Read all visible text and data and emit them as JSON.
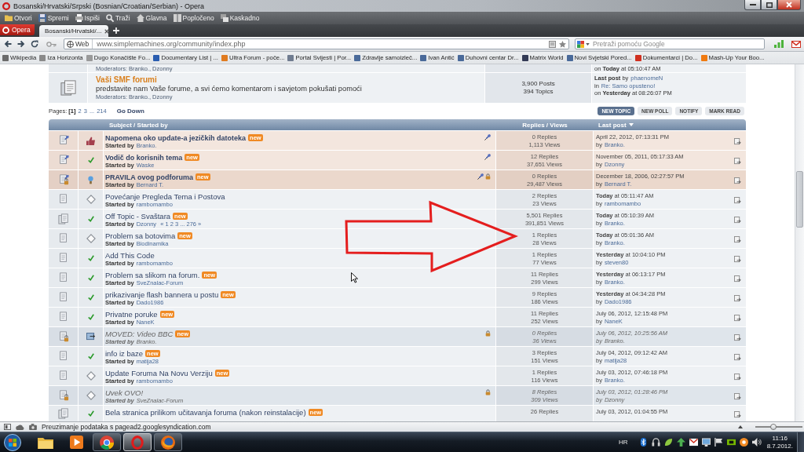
{
  "window": {
    "title": "Bosanski/Hrvatski/Srpski (Bosnian/Croatian/Serbian) - Opera"
  },
  "toolbar": [
    {
      "label": "Otvori",
      "kind": "open"
    },
    {
      "label": "Spremi",
      "kind": "save"
    },
    {
      "label": "Ispiši",
      "kind": "print"
    },
    {
      "label": "Traži",
      "kind": "find"
    },
    {
      "label": "Glavna",
      "kind": "home"
    },
    {
      "label": "Popločeno",
      "kind": "tile"
    },
    {
      "label": "Kaskadno",
      "kind": "cascade"
    }
  ],
  "tabs": {
    "menu_button": "Opera",
    "items": [
      {
        "label": "Bosanski/Hrvatski/...",
        "selected": true
      }
    ]
  },
  "address_bar": {
    "badge": "Web",
    "url": "www.simplemachines.org/community/index.php"
  },
  "search": {
    "placeholder": "Pretraži pomoću Google"
  },
  "bookmarks": [
    {
      "label": "Wikipedia",
      "color": "#6b6b6b"
    },
    {
      "label": "Iza Horizonta",
      "color": "#8a8a8a"
    },
    {
      "label": "Dugo Konačište Fo...",
      "color": "#9a9a9a"
    },
    {
      "label": "Documentary List | ...",
      "color": "#2a5db0"
    },
    {
      "label": "Ultra Forum - poče...",
      "color": "#e07b20"
    },
    {
      "label": "Portal Svijesti | Por...",
      "color": "#707c90"
    },
    {
      "label": "Zdravlje samoizleč...",
      "color": "#4a6a9a"
    },
    {
      "label": "Ivan Antić",
      "color": "#4a6a9a"
    },
    {
      "label": "Duhovni centar Dr...",
      "color": "#4a6a9a"
    },
    {
      "label": "Matrix World",
      "color": "#333a55"
    },
    {
      "label": "Novi Svjetski Pored...",
      "color": "#4a6a9a"
    },
    {
      "label": "Dokumentarci | Do...",
      "color": "#d03020"
    },
    {
      "label": "Mash-Up Your Boo...",
      "color": "#f07a10"
    }
  ],
  "boards": [
    {
      "moderators": "Moderators: Branko., Dzonny",
      "last_post": [
        {
          "text": "on **Today** at 05:10:47 AM"
        }
      ]
    },
    {
      "title": "Vaši SMF forumi",
      "description": "predstavite nam Vaše forume, a svi ćemo komentarom i savjetom pokušati pomoći",
      "moderators": "Moderators: Branko., Dzonny",
      "stats": [
        "3,900 Posts",
        "394 Topics"
      ],
      "last_post": [
        {
          "text": "**Last post** by",
          "link": "phaenomeN"
        },
        {
          "text": "in",
          "link": "Re: Samo opusteno!"
        },
        {
          "text": "on **Yesterday** at 08:26:07 PM"
        }
      ]
    }
  ],
  "pagination": {
    "label": "Pages:",
    "pages": [
      {
        "label": "[1]",
        "selected": true
      },
      {
        "label": "2",
        "selected": false
      },
      {
        "label": "3",
        "selected": false
      },
      {
        "label": "...",
        "selected": false
      },
      {
        "label": "214",
        "selected": false
      }
    ],
    "go_down": "Go Down"
  },
  "buttons": [
    {
      "label": "NEW TOPIC",
      "primary": true
    },
    {
      "label": "NEW POLL",
      "primary": false
    },
    {
      "label": "NOTIFY",
      "primary": false
    },
    {
      "label": "MARK READ",
      "primary": false
    }
  ],
  "table": {
    "columns": [
      {
        "label": "Subject / Started by",
        "sorted": false
      },
      {
        "label": "Replies / Views",
        "sorted": false
      },
      {
        "label": "Last post",
        "sorted": true
      }
    ]
  },
  "topics": [
    {
      "sticky": true,
      "locked": false,
      "hot": false,
      "message_icon": {
        "kind": "thumbup"
      },
      "subject": "Napomena oko update-a jezičkih datoteka",
      "badge": "new",
      "started_label": "Started by",
      "starter": "Branko.",
      "replies": "0 Replies",
      "views": "1,113 Views",
      "last_post": "April 22, 2012, 07:13:31 PM",
      "by_label": "by",
      "last_poster": "Branko."
    },
    {
      "sticky": true,
      "locked": false,
      "hot": false,
      "message_icon": {
        "kind": "check"
      },
      "subject": "Vodič do korisnih tema",
      "badge": "new",
      "started_label": "Started by",
      "starter": "Waske",
      "replies": "12 Replies",
      "views": "37,651 Views",
      "last_post": "November 05, 2011, 05:17:33 AM",
      "by_label": "by",
      "last_poster": "Dzonny"
    },
    {
      "sticky": true,
      "locked": true,
      "hot": false,
      "message_icon": {
        "kind": "lamp"
      },
      "subject": "PRAVILA ovog podforuma",
      "badge": "new",
      "started_label": "Started by",
      "starter": "Bernard T.",
      "replies": "0 Replies",
      "views": "29,487 Views",
      "last_post": "December 18, 2006, 02:27:57 PM",
      "by_label": "by",
      "last_poster": "Bernard T."
    },
    {
      "sticky": false,
      "locked": false,
      "hot": false,
      "message_icon": {
        "kind": "xx"
      },
      "subject": "Povećanje Pregleda Tema i Postova",
      "started_label": "Started by",
      "starter": "rambomambo",
      "replies": "2 Replies",
      "views": "23 Views",
      "last_post": "**Today** at 05:11:47 AM",
      "by_label": "by",
      "last_poster": "rambomambo"
    },
    {
      "sticky": false,
      "locked": false,
      "hot": true,
      "message_icon": {
        "kind": "check"
      },
      "subject": "Off Topic - Svaštara",
      "badge": "new",
      "started_label": "Started by",
      "starter": "Dzonny",
      "pages": "« 1 2 3 ... 276 »",
      "replies": "5,501 Replies",
      "views": "391,851 Views",
      "last_post": "**Today** at 05:10:39 AM",
      "by_label": "by",
      "last_poster": "Branko."
    },
    {
      "sticky": false,
      "locked": false,
      "hot": false,
      "message_icon": {
        "kind": "xx"
      },
      "subject": "Problem sa botovima",
      "badge": "new",
      "started_label": "Started by",
      "starter": "Biodinamika",
      "replies": "1 Replies",
      "views": "28 Views",
      "last_post": "**Today** at 05:01:36 AM",
      "by_label": "by",
      "last_poster": "Branko."
    },
    {
      "sticky": false,
      "locked": false,
      "hot": false,
      "message_icon": {
        "kind": "check"
      },
      "subject": "Add This Code",
      "started_label": "Started by",
      "starter": "rambomambo",
      "replies": "1 Replies",
      "views": "77 Views",
      "last_post": "**Yesterday** at 10:04:10 PM",
      "by_label": "by",
      "last_poster": "steven80"
    },
    {
      "sticky": false,
      "locked": false,
      "hot": false,
      "message_icon": {
        "kind": "check"
      },
      "subject": "Problem sa slikom na forum.",
      "badge": "new",
      "started_label": "Started by",
      "starter": "SveZnalac-Forum",
      "replies": "11 Replies",
      "views": "299 Views",
      "last_post": "**Yesterday** at 06:13:17 PM",
      "by_label": "by",
      "last_poster": "Branko."
    },
    {
      "sticky": false,
      "locked": false,
      "hot": false,
      "message_icon": {
        "kind": "check"
      },
      "subject": "prikazivanje flash bannera u postu",
      "badge": "new",
      "started_label": "Started by",
      "starter": "Dado1986",
      "replies": "9 Replies",
      "views": "186 Views",
      "last_post": "**Yesterday** at 04:34:28 PM",
      "by_label": "by",
      "last_poster": "Dado1986"
    },
    {
      "sticky": false,
      "locked": false,
      "hot": false,
      "message_icon": {
        "kind": "check"
      },
      "subject": "Privatne poruke",
      "badge": "new",
      "started_label": "Started by",
      "starter": "NaneK",
      "replies": "11 Replies",
      "views": "252 Views",
      "last_post": "July 06, 2012, 12:15:48 PM",
      "by_label": "by",
      "last_poster": "NaneK"
    },
    {
      "sticky": false,
      "locked": true,
      "hot": false,
      "message_icon": {
        "kind": "moved"
      },
      "subject": "MOVED: Video BBC",
      "badge": "new",
      "started_label": "Started by",
      "starter": "Branko.",
      "replies": "0 Replies",
      "views": "36 Views",
      "last_post": "July 06, 2012, 10:25:56 AM",
      "by_label": "by",
      "last_poster": "Branko."
    },
    {
      "sticky": false,
      "locked": false,
      "hot": false,
      "message_icon": {
        "kind": "check"
      },
      "subject": "info iz baze",
      "badge": "new",
      "started_label": "Started by",
      "starter": "matija28",
      "replies": "3 Replies",
      "views": "151 Views",
      "last_post": "July 04, 2012, 09:12:42 AM",
      "by_label": "by",
      "last_poster": "matija28"
    },
    {
      "sticky": false,
      "locked": false,
      "hot": false,
      "message_icon": {
        "kind": "xx"
      },
      "subject": "Update Foruma Na Novu Verziju",
      "badge": "new",
      "started_label": "Started by",
      "starter": "rambomambo",
      "replies": "1 Replies",
      "views": "116 Views",
      "last_post": "July 03, 2012, 07:46:18 PM",
      "by_label": "by",
      "last_poster": "Branko."
    },
    {
      "sticky": false,
      "locked": true,
      "hot": false,
      "message_icon": {
        "kind": "xx"
      },
      "subject": "Uvek OVO!",
      "started_label": "Started by",
      "starter": "SveZnalac-Forum",
      "replies": "8 Replies",
      "views": "309 Views",
      "last_post": "July 03, 2012, 01:28:46 PM",
      "by_label": "by",
      "last_poster": "Dzonny"
    },
    {
      "sticky": false,
      "locked": false,
      "hot": true,
      "message_icon": {
        "kind": "check"
      },
      "subject": "Bela stranica prilikom učitavanja foruma (nakon reinstalacije)",
      "badge": "new",
      "replies": "26 Replies",
      "last_post": "July 03, 2012, 01:04:55 PM"
    }
  ],
  "status_bar": {
    "text": "Preuzimanje podataka s pagead2.googlesyndication.com",
    "zoom": {
      "level": 0.36
    }
  },
  "taskbar": {
    "apps": [
      {
        "kind": "folder",
        "running": false,
        "selected": false
      },
      {
        "kind": "media",
        "running": false,
        "selected": false
      },
      {
        "kind": "chrome",
        "running": true,
        "selected": false
      },
      {
        "kind": "opera",
        "running": true,
        "selected": true
      },
      {
        "kind": "firefox",
        "running": true,
        "selected": false
      }
    ],
    "language": "HR",
    "time": "11:16",
    "date": "8.7.2012."
  }
}
